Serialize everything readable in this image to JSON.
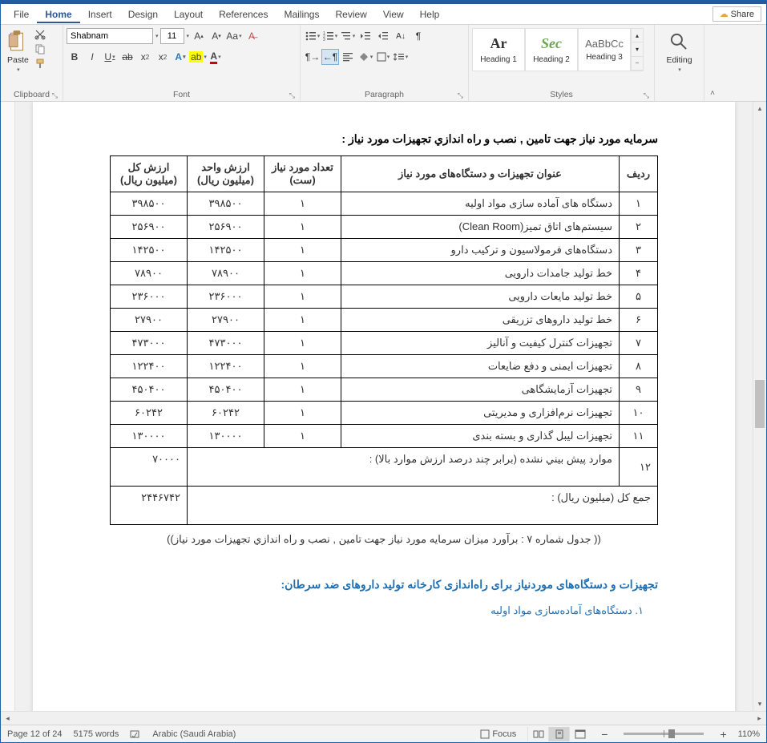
{
  "menubar": {
    "items": [
      "File",
      "Home",
      "Insert",
      "Design",
      "Layout",
      "References",
      "Mailings",
      "Review",
      "View",
      "Help"
    ],
    "active_index": 1,
    "share": "Share"
  },
  "ribbon": {
    "clipboard": {
      "paste": "Paste",
      "label": "Clipboard"
    },
    "font": {
      "label": "Font",
      "name": "Shabnam",
      "size": "11"
    },
    "paragraph": {
      "label": "Paragraph"
    },
    "styles": {
      "label": "Styles",
      "items": [
        {
          "preview": "Ar",
          "name": "Heading 1"
        },
        {
          "preview": "Sec",
          "name": "Heading 2"
        },
        {
          "preview": "AaBbCc",
          "name": "Heading 3"
        }
      ]
    },
    "editing": {
      "label": "Editing"
    }
  },
  "document": {
    "title": "سرمايه مورد نياز جهت تامين , نصب و راه اندازي تجهيزات مورد نياز :",
    "headers": {
      "row": "رديف",
      "desc": "عنوان تجهیزات و دستگاه‌های مورد نیاز",
      "qty": "تعداد مورد نیاز (ست)",
      "unit": "ارزش واحد (ميليون ريال)",
      "total": "ارزش كل (ميليون ريال)"
    },
    "rows": [
      {
        "n": "۱",
        "desc": "دستگاه های آماده سازی مواد اولیه",
        "qty": "۱",
        "unit": "۳۹۸۵۰۰",
        "total": "۳۹۸۵۰۰"
      },
      {
        "n": "۲",
        "desc": "سیستم‌های اتاق تمیز(Clean Room)",
        "qty": "۱",
        "unit": "۲۵۶۹۰۰",
        "total": "۲۵۶۹۰۰"
      },
      {
        "n": "۳",
        "desc": "دستگاه‌های فرمولاسیون و ترکیب دارو",
        "qty": "۱",
        "unit": "۱۴۲۵۰۰",
        "total": "۱۴۲۵۰۰"
      },
      {
        "n": "۴",
        "desc": "خط تولید جامدات دارویی",
        "qty": "۱",
        "unit": "۷۸۹۰۰",
        "total": "۷۸۹۰۰"
      },
      {
        "n": "۵",
        "desc": "خط تولید مایعات دارویی",
        "qty": "۱",
        "unit": "۲۳۶۰۰۰",
        "total": "۲۳۶۰۰۰"
      },
      {
        "n": "۶",
        "desc": "خط تولید داروهای تزریقی",
        "qty": "۱",
        "unit": "۲۷۹۰۰",
        "total": "۲۷۹۰۰"
      },
      {
        "n": "۷",
        "desc": "تجهیزات کنترل کیفیت و آنالیز",
        "qty": "۱",
        "unit": "۴۷۳۰۰۰",
        "total": "۴۷۳۰۰۰"
      },
      {
        "n": "۸",
        "desc": "تجهیزات ایمنی و دفع ضایعات",
        "qty": "۱",
        "unit": "۱۲۲۴۰۰",
        "total": "۱۲۲۴۰۰"
      },
      {
        "n": "۹",
        "desc": "تجهیزات آزمایشگاهی",
        "qty": "۱",
        "unit": "۴۵۰۴۰۰",
        "total": "۴۵۰۴۰۰"
      },
      {
        "n": "۱۰",
        "desc": "تجهیزات نرم‌افزاری و مدیریتی",
        "qty": "۱",
        "unit": "۶۰۲۴۲",
        "total": "۶۰۲۴۲"
      },
      {
        "n": "۱۱",
        "desc": "تجهیزات لیبل گذاری و بسته بندی",
        "qty": "۱",
        "unit": "۱۳۰۰۰۰",
        "total": "۱۳۰۰۰۰"
      }
    ],
    "unforeseen": {
      "n": "۱۲",
      "desc": "موارد پيش بيني نشده (برابر چند درصد ارزش موارد بالا) :",
      "total": "۷۰۰۰۰"
    },
    "grand": {
      "label": "جمع كل (ميليون ريال) :",
      "total": "۲۴۴۶۷۴۲"
    },
    "caption": "(( جدول شماره ۷ : برآورد میزان سرمايه مورد نياز جهت تامين , نصب و راه اندازي تجهيزات مورد نياز))",
    "section_title": "تجهیزات و دستگاه‌های موردنیاز برای راه‌اندازی کارخانه تولید داروهای ضد سرطان:",
    "list1": "۱. دستگاه‌های آماده‌سازی مواد اولیه"
  },
  "statusbar": {
    "page": "Page 12 of 24",
    "words": "5175 words",
    "lang": "Arabic (Saudi Arabia)",
    "focus": "Focus",
    "zoom": "110%"
  }
}
